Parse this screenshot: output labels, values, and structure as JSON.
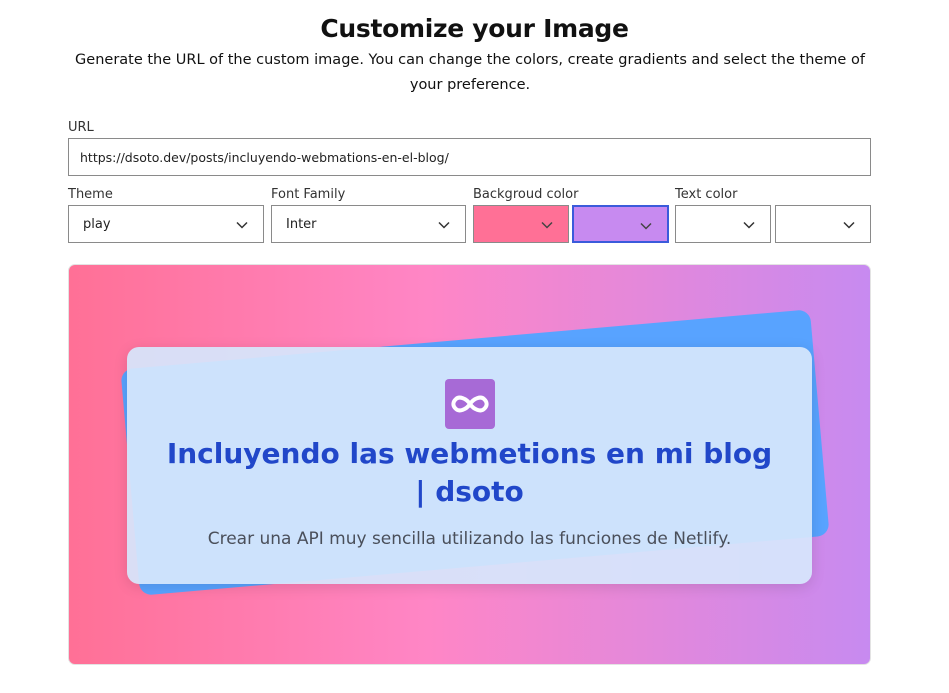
{
  "header": {
    "title": "Customize your Image",
    "subtitle": "Generate the URL of the custom image. You can change the colors, create gradients and select the theme of your preference."
  },
  "form": {
    "url_label": "URL",
    "url_value": "https://dsoto.dev/posts/incluyendo-webmations-en-el-blog/",
    "theme_label": "Theme",
    "theme_value": "play",
    "font_label": "Font Family",
    "font_value": "Inter",
    "bg_label": "Backgroud color",
    "bg_color_1": "#ff7096",
    "bg_color_2": "#c78af0",
    "text_label": "Text color",
    "text_color_1": "#ffffff",
    "text_color_2": "#ffffff"
  },
  "preview": {
    "gradient_start": "#ff7096",
    "gradient_mid": "#ff86c6",
    "gradient_end": "#c78af0",
    "back_card_color": "#58a3ff",
    "logo_color": "#a76ad6",
    "title": "Incluyendo las webmetions en mi blog | dsoto",
    "description": "Crear una API muy sencilla utilizando las funciones de Netlify.",
    "logo_icon": "infinity-icon"
  },
  "icons": {
    "chevron": "chevron-down-icon"
  }
}
